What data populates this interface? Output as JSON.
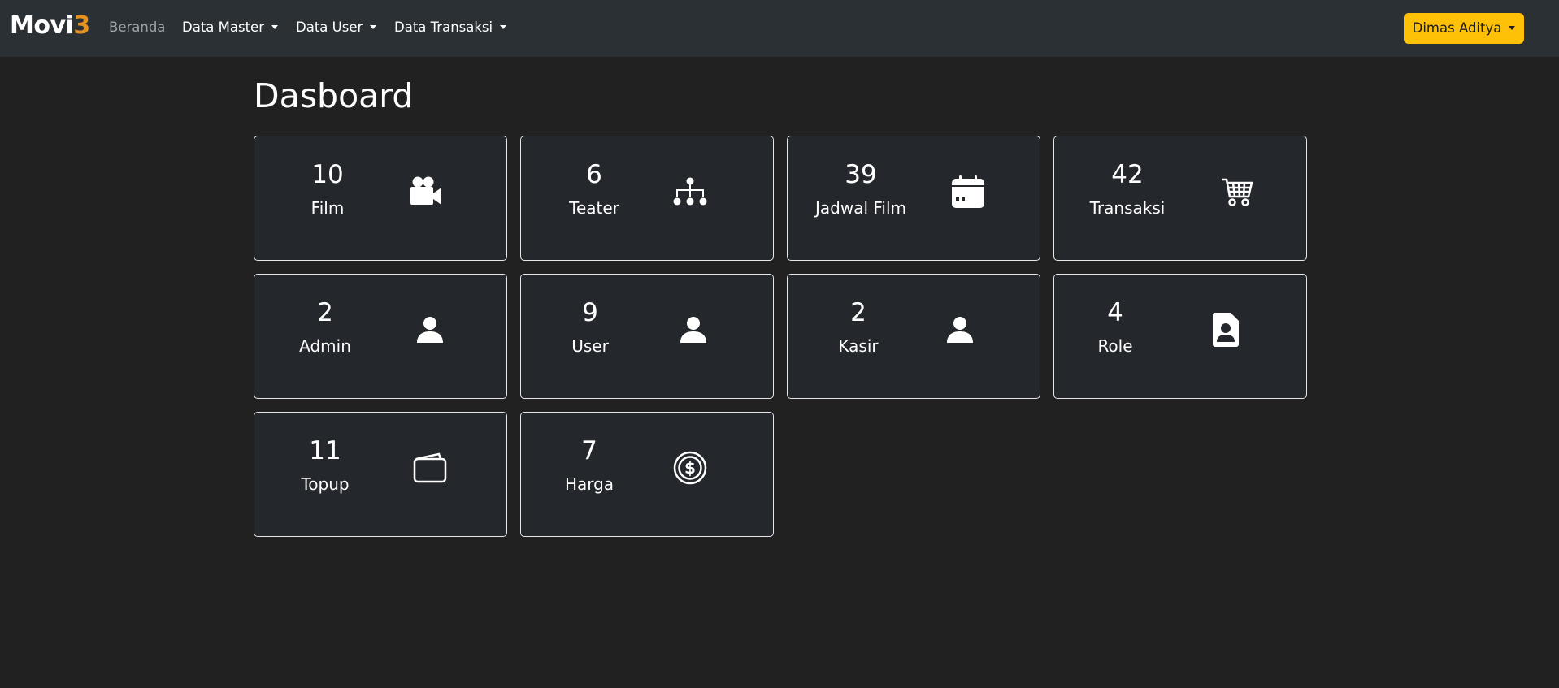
{
  "navbar": {
    "brand_main": "Movi",
    "brand_accent": "3",
    "links": [
      {
        "label": "Beranda"
      },
      {
        "label": "Data Master"
      },
      {
        "label": "Data User"
      },
      {
        "label": "Data Transaksi"
      }
    ],
    "user_menu": "Dimas Aditya"
  },
  "page": {
    "title": "Dasboard"
  },
  "cards": [
    {
      "value": "10",
      "label": "Film",
      "icon": "video-camera-icon"
    },
    {
      "value": "6",
      "label": "Teater",
      "icon": "sitemap-icon"
    },
    {
      "value": "39",
      "label": "Jadwal Film",
      "icon": "calendar-icon"
    },
    {
      "value": "42",
      "label": "Transaksi",
      "icon": "cart-icon"
    },
    {
      "value": "2",
      "label": "Admin",
      "icon": "person-icon"
    },
    {
      "value": "9",
      "label": "User",
      "icon": "person-icon"
    },
    {
      "value": "2",
      "label": "Kasir",
      "icon": "person-icon"
    },
    {
      "value": "4",
      "label": "Role",
      "icon": "person-badge-icon"
    },
    {
      "value": "11",
      "label": "Topup",
      "icon": "wallet-icon"
    },
    {
      "value": "7",
      "label": "Harga",
      "icon": "coin-icon"
    }
  ],
  "colors": {
    "navbar_bg": "#2b3035",
    "page_bg": "#212121",
    "brand_accent": "#e8901e",
    "user_button": "#ffc107"
  }
}
